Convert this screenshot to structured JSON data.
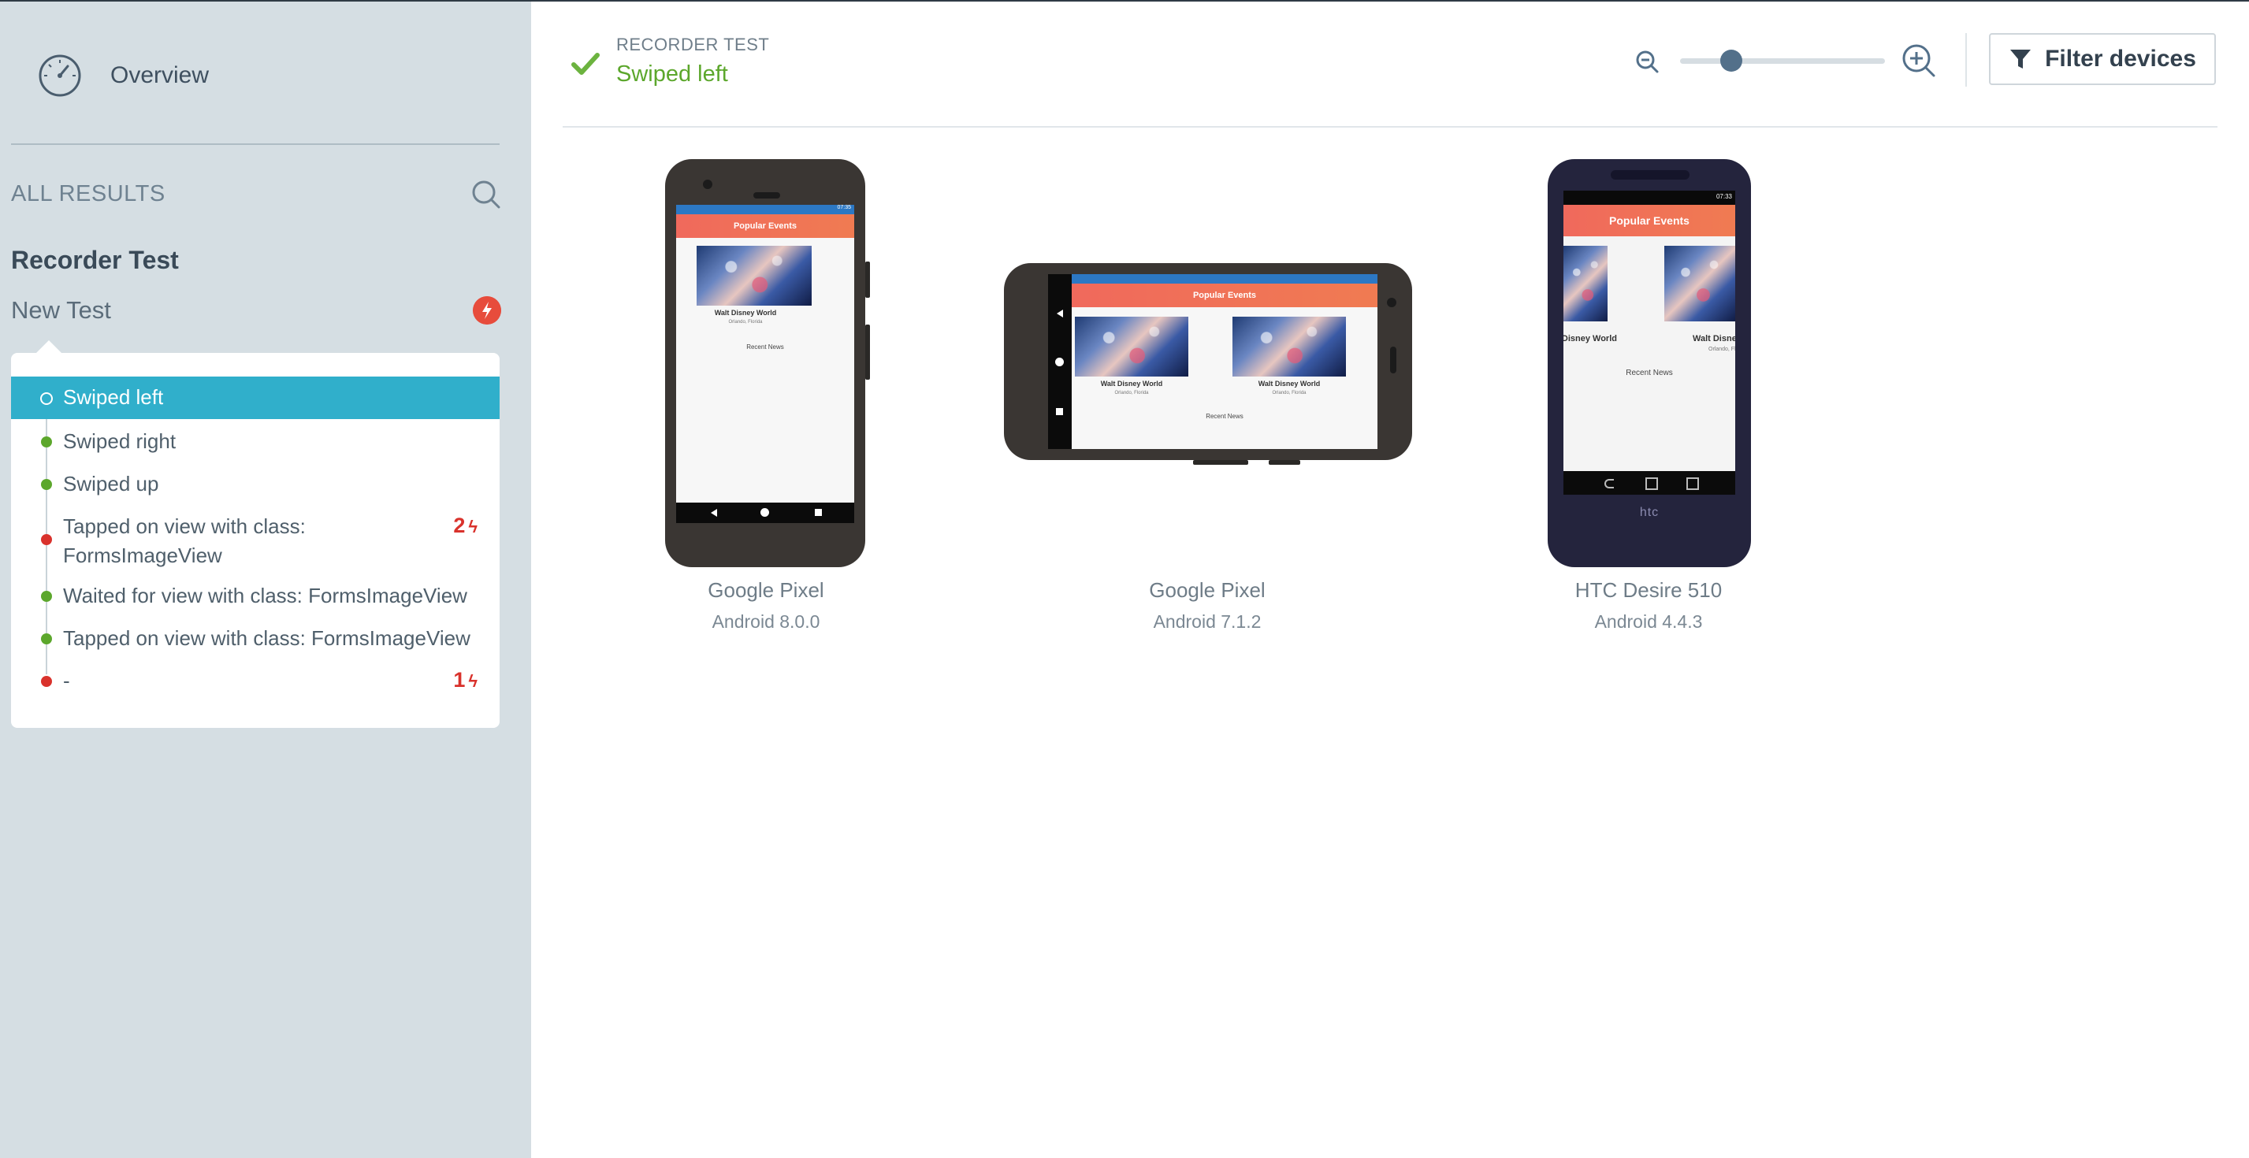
{
  "sidebar": {
    "overview_label": "Overview",
    "all_results_label": "ALL RESULTS",
    "test_suite": "Recorder Test",
    "test_name": "New Test",
    "steps": [
      {
        "label": "Swiped left",
        "status": "passed",
        "active": true
      },
      {
        "label": "Swiped right",
        "status": "passed"
      },
      {
        "label": "Swiped up",
        "status": "passed"
      },
      {
        "label": "Tapped on view with class: FormsImageView",
        "status": "failed",
        "fail_count": "2"
      },
      {
        "label": "Waited for view with class: FormsImageView",
        "status": "passed"
      },
      {
        "label": "Tapped on view with class: FormsImageView",
        "status": "passed"
      },
      {
        "label": "-",
        "status": "failed",
        "fail_count": "1"
      }
    ]
  },
  "header": {
    "breadcrumb": "RECORDER TEST",
    "step_title": "Swiped left",
    "zoom_level": 0.25,
    "filter_button": "Filter devices"
  },
  "app_screen": {
    "bar_title": "Popular Events",
    "event_title": "Walt Disney World",
    "event_location": "Orlando, Florida",
    "section": "Recent News",
    "htc_logo": "htc",
    "status_time_1": "07:35",
    "status_time_3": "07:33"
  },
  "devices": [
    {
      "name": "Google Pixel",
      "os": "Android 8.0.0"
    },
    {
      "name": "Google Pixel",
      "os": "Android 7.1.2"
    },
    {
      "name": "HTC Desire 510",
      "os": "Android 4.4.3"
    }
  ],
  "colors": {
    "accent": "#30afcb",
    "passed": "#5ca72c",
    "failed": "#d9322c",
    "sidebar_bg": "#d5dee3"
  }
}
